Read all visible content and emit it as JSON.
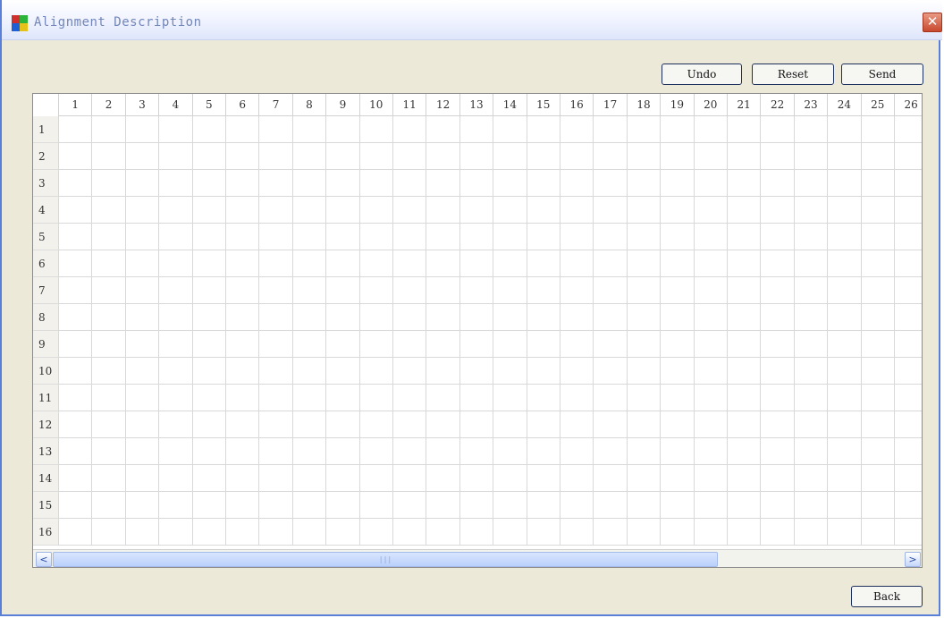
{
  "window": {
    "title": "Alignment Description",
    "close_label": "✕"
  },
  "toolbar": {
    "undo_label": "Undo",
    "reset_label": "Reset",
    "send_label": "Send"
  },
  "grid": {
    "columns": [
      "1",
      "2",
      "3",
      "4",
      "5",
      "6",
      "7",
      "8",
      "9",
      "10",
      "11",
      "12",
      "13",
      "14",
      "15",
      "16",
      "17",
      "18",
      "19",
      "20",
      "21",
      "22",
      "23",
      "24",
      "25",
      "26"
    ],
    "rows": [
      "1",
      "2",
      "3",
      "4",
      "5",
      "6",
      "7",
      "8",
      "9",
      "10",
      "11",
      "12",
      "13",
      "14",
      "15",
      "16"
    ]
  },
  "scrollbar": {
    "left_arrow": "<",
    "right_arrow": ">",
    "thumb_grip": "|||"
  },
  "footer": {
    "back_label": "Back"
  },
  "colors": {
    "titlebar_text": "#7286b8",
    "close_button": "#c8492d",
    "window_bg": "#ece9d8"
  },
  "icons": {
    "app": "app-grid-icon",
    "close": "close-icon"
  }
}
